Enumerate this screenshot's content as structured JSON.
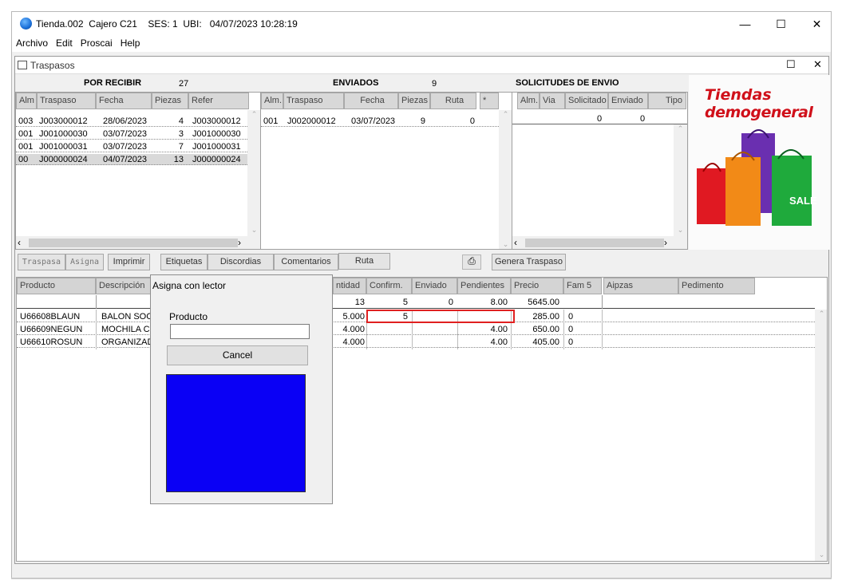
{
  "window": {
    "title_store": "Tienda.002",
    "title_cashier": "Cajero C21",
    "title_session": "SES: 1",
    "title_ubi": "UBI:",
    "title_datetime": "04/07/2023 10:28:19",
    "minimize": "—",
    "maximize": "☐",
    "close": "✕"
  },
  "menu": [
    "Archivo",
    "Edit",
    "Proscai",
    "Help"
  ],
  "subwindow": {
    "title": "Traspasos",
    "maximize": "☐",
    "close": "✕"
  },
  "por_recibir": {
    "title": "POR RECIBIR",
    "count": "27",
    "headers": [
      "Alm",
      "Traspaso",
      "Fecha",
      "Piezas",
      "Refer"
    ],
    "rows": [
      [
        "003",
        "J003000012",
        "28/06/2023",
        "4",
        "J003000012"
      ],
      [
        "001",
        "J001000030",
        "03/07/2023",
        "3",
        "J001000030"
      ],
      [
        "001",
        "J001000031",
        "03/07/2023",
        "7",
        "J001000031"
      ],
      [
        "00",
        "J000000024",
        "04/07/2023",
        "13",
        "J000000024"
      ]
    ]
  },
  "enviados": {
    "title": "ENVIADOS",
    "count": "9",
    "headers": [
      "Alm.",
      "Traspaso",
      "Fecha",
      "Piezas",
      "Ruta",
      "*"
    ],
    "rows": [
      [
        "001",
        "J002000012",
        "03/07/2023",
        "9",
        "0"
      ]
    ]
  },
  "solicitudes": {
    "title": "SOLICITUDES DE ENVIO",
    "headers": [
      "Alm.",
      "Via",
      "Solicitado",
      "Enviado",
      "Tipo"
    ],
    "totals": [
      "0",
      "0"
    ]
  },
  "promo": {
    "line1": "Tiendas",
    "line2": "demogeneral",
    "sale": "SALE"
  },
  "toolbar": {
    "traspasa": "Traspasa",
    "asigna": "Asigna",
    "imprimir": "Imprimir",
    "etiquetas": "Etiquetas",
    "discordias": "Discordias",
    "comentarios": "Comentarios",
    "ruta": "Ruta",
    "genera": "Genera Traspaso"
  },
  "detail": {
    "headers": [
      "Producto",
      "Descripción",
      "ntidad",
      "Confirm.",
      "Enviado",
      "Pendientes",
      "Precio",
      "Fam 5",
      "Aipzas",
      "Pedimento"
    ],
    "totals": {
      "cantidad": "13",
      "confirm": "5",
      "enviado": "0",
      "pendientes": "8.00",
      "precio": "5645.00"
    },
    "rows": [
      {
        "producto": "U66608BLAUN",
        "descripcion": "BALON SOCC",
        "cantidad": "5.000",
        "confirm": "5",
        "enviado": "",
        "pendientes": "",
        "precio": "285.00",
        "fam": "0"
      },
      {
        "producto": "U66609NEGUN",
        "descripcion": "MOCHILA CL",
        "cantidad": "4.000",
        "confirm": "",
        "enviado": "",
        "pendientes": "4.00",
        "precio": "650.00",
        "fam": "0"
      },
      {
        "producto": "U66610ROSUN",
        "descripcion": "ORGANIZAD",
        "cantidad": "4.000",
        "confirm": "",
        "enviado": "",
        "pendientes": "4.00",
        "precio": "405.00",
        "fam": "0"
      }
    ]
  },
  "dialog": {
    "title": "Asigna con lector",
    "label": "Producto",
    "input_value": "",
    "cancel": "Cancel"
  },
  "colors": {
    "highlight_row": "#d9d9d9",
    "edit_border": "#e02020",
    "scanner_preview": "#0a00f5",
    "promo_red": "#d0101a",
    "app_icon": "#1a6fd8"
  }
}
